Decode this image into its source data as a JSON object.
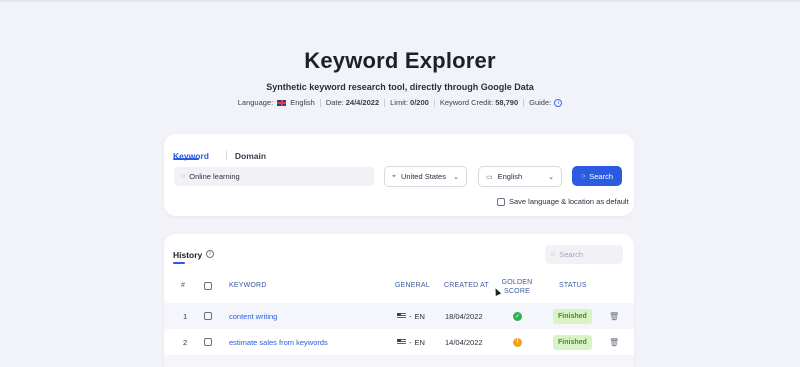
{
  "header": {
    "title": "Keyword Explorer",
    "subtitle": "Synthetic keyword research tool, directly through Google Data",
    "meta": {
      "language_label": "Language:",
      "language_value": "English",
      "date_label": "Date:",
      "date_value": "24/4/2022",
      "limit_label": "Limit:",
      "limit_value": "0/200",
      "credit_label": "Keyword Credit:",
      "credit_value": "58,790",
      "guide_label": "Guide:"
    }
  },
  "search_card": {
    "tabs": [
      {
        "label": "Keyword",
        "active": true
      },
      {
        "label": "Domain",
        "active": false
      }
    ],
    "keyword_value": "Online learning",
    "location_value": "United States",
    "language_value": "English",
    "search_label": "Search",
    "save_default_label": "Save language & location as default",
    "accent_color": "#2a5be0"
  },
  "history": {
    "title": "History",
    "search_placeholder": "Search",
    "columns": {
      "index": "#",
      "keyword": "KEYWORD",
      "general": "GENERAL",
      "created_at": "CREATED AT",
      "golden_score": "GOLDEN SCORE",
      "status": "STATUS"
    },
    "rows": [
      {
        "index": "1",
        "keyword": "content writing",
        "general": "EN",
        "created_at": "18/04/2022",
        "golden_score": "ok",
        "status": "Finished"
      },
      {
        "index": "2",
        "keyword": "estimate sales from keywords",
        "general": "EN",
        "created_at": "14/04/2022",
        "golden_score": "warning",
        "status": "Finished"
      }
    ]
  }
}
